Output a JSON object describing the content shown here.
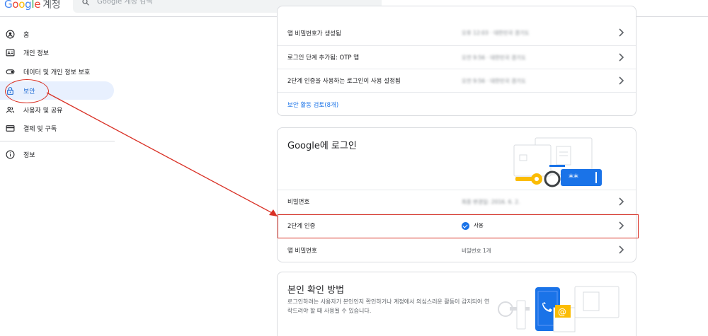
{
  "header": {
    "brand": "Google",
    "service": "계정",
    "search_placeholder": "Google 계정 검색"
  },
  "sidebar": {
    "items": [
      {
        "label": "홈",
        "icon": "account-circle-icon"
      },
      {
        "label": "개인 정보",
        "icon": "id-card-icon"
      },
      {
        "label": "데이터 및 개인 정보 보호",
        "icon": "toggle-icon"
      },
      {
        "label": "보안",
        "icon": "lock-icon",
        "active": true
      },
      {
        "label": "사용자 및 공유",
        "icon": "people-icon"
      },
      {
        "label": "결제 및 구독",
        "icon": "credit-card-icon"
      },
      {
        "label": "정보",
        "icon": "info-icon"
      }
    ]
  },
  "activity": {
    "rows": [
      {
        "label": "앱 비밀번호가 생성됨",
        "value": "오후 12:03 · 대한민국 경기도"
      },
      {
        "label": "로그인 단계 추가됨: OTP 앱",
        "value": "오전 9:56 · 대한민국 경기도"
      },
      {
        "label": "2단계 인증을 사용하는 로그인이 사용 설정됨",
        "value": "오전 9:56 · 대한민국 경기도"
      }
    ],
    "review_link": "보안 활동 검토(8개)"
  },
  "signin": {
    "title": "Google에 로그인",
    "rows": [
      {
        "label": "비밀번호",
        "value": "최종 변경일: 2016. 6. 2."
      },
      {
        "label": "2단계 인증",
        "value": "사용"
      },
      {
        "label": "앱 비밀번호",
        "value": "비밀번호 1개"
      }
    ]
  },
  "verify": {
    "title": "본인 확인 방법",
    "description": "로그인하려는 사용자가 본인인지 확인하거나 계정에서 의심스러운 활동이 감지되어 연락드려야 할 때 사용될 수 있습니다."
  },
  "colors": {
    "accent": "#1a73e8",
    "active_bg": "#e8f0fe",
    "annotation": "#d93025",
    "key_yellow": "#fbbc04",
    "phone_blue": "#1a73e8"
  }
}
